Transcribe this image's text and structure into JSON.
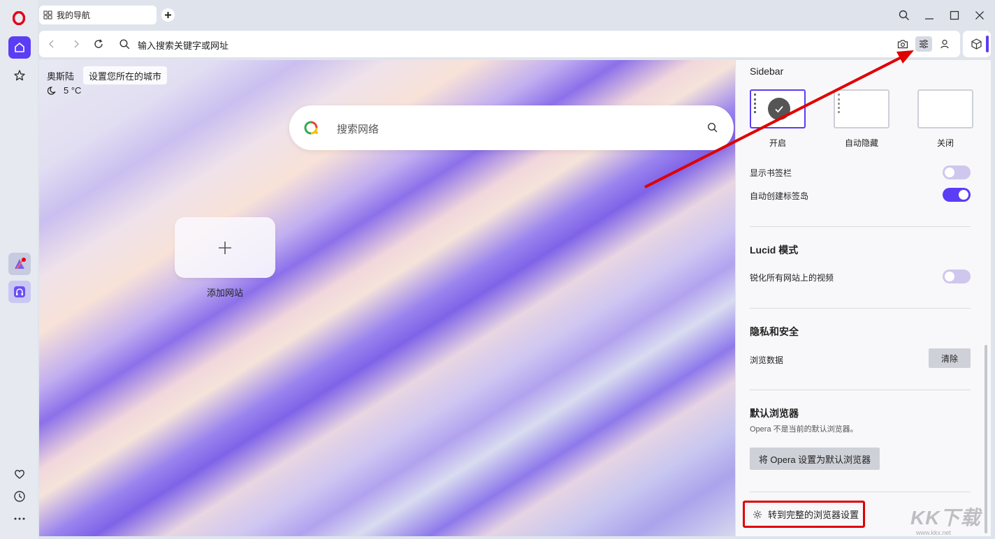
{
  "tab": {
    "title": "我的导航"
  },
  "addressbar": {
    "placeholder": "输入搜索关键字或网址"
  },
  "weather": {
    "city": "奥斯陆",
    "city_tip": "设置您所在的城市",
    "temp": "5 °C"
  },
  "search": {
    "placeholder": "搜索网络"
  },
  "speed_dial": {
    "add_label": "添加网站"
  },
  "panel": {
    "sidebar_title": "Sidebar",
    "sidebar_options": [
      {
        "label": "开启",
        "selected": true
      },
      {
        "label": "自动隐藏",
        "selected": false
      },
      {
        "label": "关闭",
        "selected": false
      }
    ],
    "show_bookmarks": {
      "label": "显示书签栏",
      "on": false
    },
    "auto_tab_islands": {
      "label": "自动创建标签岛",
      "on": true
    },
    "lucid": {
      "title": "Lucid 模式",
      "label": "锐化所有网站上的视频",
      "on": false
    },
    "privacy": {
      "title": "隐私和安全",
      "label": "浏览数据",
      "button": "清除"
    },
    "default_browser": {
      "title": "默认浏览器",
      "sub": "Opera 不是当前的默认浏览器。",
      "button": "将 Opera 设置为默认浏览器"
    },
    "full_settings": "转到完整的浏览器设置"
  },
  "watermark": {
    "text": "KK下载",
    "url": "www.kkx.net"
  },
  "colors": {
    "accent": "#5b3df5",
    "highlight_box": "#e00000",
    "arrow": "#e00000"
  }
}
